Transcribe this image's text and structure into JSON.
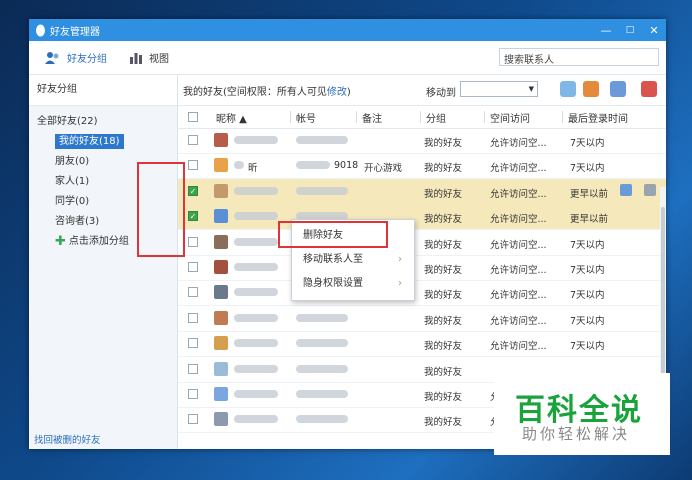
{
  "window": {
    "title": "好友管理器",
    "controls": [
      "—",
      "□",
      "✕"
    ]
  },
  "toolbar": {
    "friend_groups": "好友分组",
    "view": "视图",
    "search_placeholder": "搜索联系人"
  },
  "sidebar": {
    "header": "好友分组",
    "all_friends": "全部好友(22)",
    "groups": [
      {
        "label": "我的好友(18)",
        "selected": true
      },
      {
        "label": "朋友(0)"
      },
      {
        "label": "家人(1)"
      },
      {
        "label": "同学(0)"
      },
      {
        "label": "咨询者(3)"
      }
    ],
    "add_group": "点击添加分组",
    "recover": "找回被删的好友"
  },
  "main": {
    "perm_prefix": "我的好友(空间权限：所有人可见",
    "perm_link": "修改",
    "perm_suffix": ")",
    "move_to": "移动到"
  },
  "columns": {
    "nickname": "昵称 ▲",
    "account": "帐号",
    "remark": "备注",
    "group": "分组",
    "space": "空间访问",
    "last_login": "最后登录时间"
  },
  "rows": [
    {
      "nickname": "",
      "account": "",
      "remark": "",
      "group": "我的好友",
      "space": "允许访问空...",
      "last": "7天以内",
      "checked": false,
      "selected": false
    },
    {
      "nickname": "昕",
      "account": "9018",
      "remark": "开心游戏",
      "group": "我的好友",
      "space": "允许访问空...",
      "last": "7天以内",
      "checked": false,
      "selected": false
    },
    {
      "nickname": "",
      "account": "",
      "remark": "",
      "group": "我的好友",
      "space": "允许访问空...",
      "last": "更早以前",
      "checked": true,
      "selected": true
    },
    {
      "nickname": "",
      "account": "",
      "remark": "",
      "group": "我的好友",
      "space": "允许访问空...",
      "last": "更早以前",
      "checked": true,
      "selected": true
    },
    {
      "nickname": "",
      "account": "",
      "remark": "",
      "group": "我的好友",
      "space": "允许访问空...",
      "last": "7天以内",
      "checked": false,
      "selected": false
    },
    {
      "nickname": "",
      "account": "",
      "remark": "",
      "group": "我的好友",
      "space": "允许访问空...",
      "last": "7天以内",
      "checked": false,
      "selected": false
    },
    {
      "nickname": "",
      "account": "",
      "remark": "",
      "group": "我的好友",
      "space": "允许访问空...",
      "last": "7天以内",
      "checked": false,
      "selected": false
    },
    {
      "nickname": "",
      "account": "",
      "remark": "",
      "group": "我的好友",
      "space": "允许访问空...",
      "last": "7天以内",
      "checked": false,
      "selected": false
    },
    {
      "nickname": "",
      "account": "",
      "remark": "",
      "group": "我的好友",
      "space": "允许访问空...",
      "last": "7天以内",
      "checked": false,
      "selected": false
    },
    {
      "nickname": "",
      "account": "",
      "remark": "",
      "group": "我的好友",
      "space": "",
      "last": "",
      "checked": false,
      "selected": false
    },
    {
      "nickname": "",
      "account": "",
      "remark": "",
      "group": "我的好友",
      "space": "允",
      "last": "",
      "checked": false,
      "selected": false
    },
    {
      "nickname": "",
      "account": "",
      "remark": "",
      "group": "我的好友",
      "space": "允",
      "last": "",
      "checked": false,
      "selected": false
    }
  ],
  "context_menu": [
    {
      "label": "删除好友",
      "submenu": false
    },
    {
      "label": "移动联系人至",
      "submenu": true
    },
    {
      "label": "隐身权限设置",
      "submenu": true
    }
  ],
  "watermark": {
    "big": "百科全说",
    "small": "助你轻松解决"
  },
  "colors": {
    "titlebar": "#2f8fe0",
    "selection": "#f5e9bc",
    "highlight_box": "#e0333a",
    "watermark_green": "#1aa33a"
  }
}
